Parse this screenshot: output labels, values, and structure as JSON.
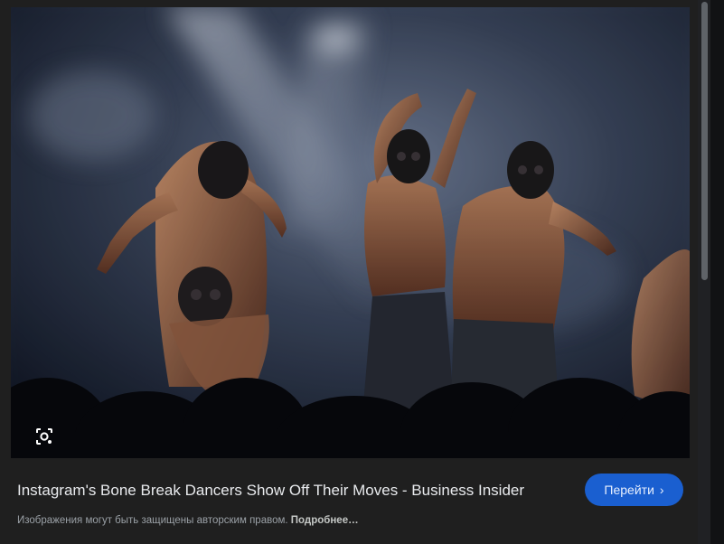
{
  "image": {
    "alt": "Instagram's Bone Break Dancers Show Off Their Moves - Business Insider"
  },
  "lens": {
    "icon": "lens-search-icon"
  },
  "result": {
    "title": "Instagram's Bone Break Dancers Show Off Their Moves - Business Insider",
    "visit_label": "Перейти",
    "visit_icon": "chevron-right-icon",
    "copyright_text": "Изображения могут быть защищены авторским правом.",
    "more_label": "Подробнее…"
  },
  "colors": {
    "background": "#1f1f1f",
    "accent": "#1a5fd0",
    "title_text": "#e8eaed",
    "muted_text": "#9aa0a6"
  }
}
